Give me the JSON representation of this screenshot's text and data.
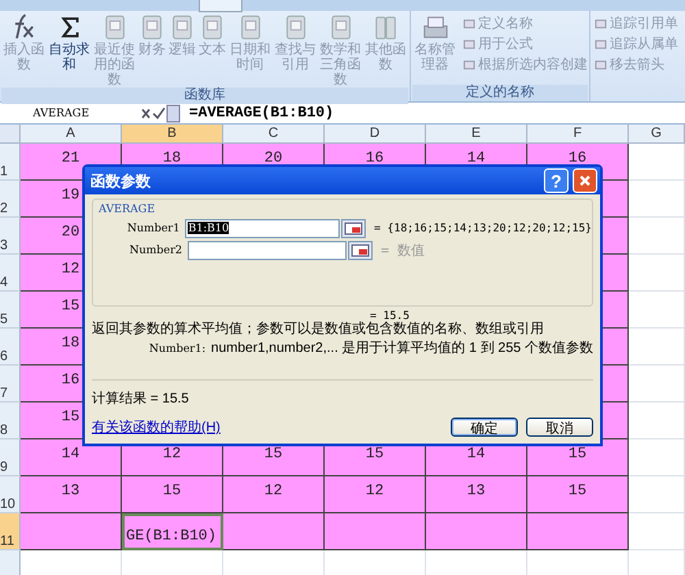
{
  "ribbon": {
    "groups": [
      {
        "label": "函数库",
        "buttons": [
          {
            "label": "插入函数",
            "kind": "fx",
            "disabled": true
          },
          {
            "label": "自动求和",
            "kind": "sigma",
            "disabled": false
          },
          {
            "label": "最近使用的函数",
            "kind": "book",
            "disabled": true
          },
          {
            "label": "财务",
            "kind": "book",
            "disabled": true
          },
          {
            "label": "逻辑",
            "kind": "book",
            "disabled": true
          },
          {
            "label": "文本",
            "kind": "book",
            "disabled": true
          },
          {
            "label": "日期和时间",
            "kind": "book",
            "disabled": true
          },
          {
            "label": "查找与引用",
            "kind": "book",
            "disabled": true
          },
          {
            "label": "数学和三角函数",
            "kind": "book",
            "disabled": true
          },
          {
            "label": "其他函数",
            "kind": "books",
            "disabled": true
          }
        ]
      },
      {
        "label": "定义的名称",
        "buttons": [
          {
            "label": "名称管理器",
            "kind": "manager",
            "disabled": true
          },
          {
            "label": "定义名称",
            "kind": "small",
            "disabled": true
          },
          {
            "label": "用于公式",
            "kind": "small",
            "disabled": true
          },
          {
            "label": "根据所选内容创建",
            "kind": "small",
            "disabled": true
          }
        ]
      },
      {
        "buttons": [
          {
            "label": "追踪引用单",
            "kind": "small",
            "disabled": true
          },
          {
            "label": "追踪从属单",
            "kind": "small",
            "disabled": true
          },
          {
            "label": "移去箭头",
            "kind": "small",
            "disabled": true
          }
        ]
      }
    ]
  },
  "formula_bar": {
    "name_box": "AVERAGE",
    "formula": "=AVERAGE(B1:B10)"
  },
  "sheet": {
    "columns": [
      {
        "label": "A",
        "selected": false
      },
      {
        "label": "B",
        "selected": true
      },
      {
        "label": "C",
        "selected": false
      },
      {
        "label": "D",
        "selected": false
      },
      {
        "label": "E",
        "selected": false
      },
      {
        "label": "F",
        "selected": false
      },
      {
        "label": "G",
        "selected": false
      }
    ],
    "rows": [
      {
        "label": "1",
        "selected": false,
        "cells": [
          "21",
          "18",
          "20",
          "16",
          "14",
          "16"
        ]
      },
      {
        "label": "2",
        "selected": false,
        "cells": [
          "19",
          null,
          null,
          null,
          null,
          null
        ]
      },
      {
        "label": "3",
        "selected": false,
        "cells": [
          "20",
          null,
          null,
          null,
          null,
          null
        ]
      },
      {
        "label": "4",
        "selected": false,
        "cells": [
          "12",
          null,
          null,
          null,
          null,
          null
        ]
      },
      {
        "label": "5",
        "selected": false,
        "cells": [
          "15",
          null,
          null,
          null,
          null,
          null
        ]
      },
      {
        "label": "6",
        "selected": false,
        "cells": [
          "18",
          null,
          null,
          null,
          null,
          null
        ]
      },
      {
        "label": "7",
        "selected": false,
        "cells": [
          "16",
          null,
          null,
          null,
          null,
          null
        ]
      },
      {
        "label": "8",
        "selected": false,
        "cells": [
          "15",
          null,
          null,
          null,
          null,
          null
        ]
      },
      {
        "label": "9",
        "selected": false,
        "cells": [
          "14",
          "12",
          "15",
          "15",
          "14",
          "15"
        ]
      },
      {
        "label": "10",
        "selected": false,
        "cells": [
          "13",
          "15",
          "12",
          "12",
          "13",
          "15"
        ]
      },
      {
        "label": "11",
        "selected": true,
        "cells": [
          null,
          "GE(B1:B10)",
          null,
          null,
          null,
          null
        ]
      }
    ]
  },
  "dialog": {
    "title": "函数参数",
    "help": "?",
    "function": "AVERAGE",
    "args": [
      {
        "name": "Number1",
        "value": "B1:B10",
        "value_selected": true,
        "result": "= {18;16;15;14;13;20;12;20;12;15}",
        "result_hint": false
      },
      {
        "name": "Number2",
        "result": "= 数值",
        "result_hint": true
      }
    ],
    "formula_result": "= 15.5",
    "description": "返回其参数的算术平均值；参数可以是数值或包含数值的名称、数组或引用",
    "arg_name": "Number1:",
    "arg_description": "number1,number2,... 是用于计算平均值的 1 到 255 个数值参数",
    "calc_result": "计算结果 = 15.5",
    "help_link": "有关该函数的帮助(H)",
    "buttons": [
      {
        "label": "确定",
        "default": true
      },
      {
        "label": "取消",
        "default": false
      }
    ]
  }
}
